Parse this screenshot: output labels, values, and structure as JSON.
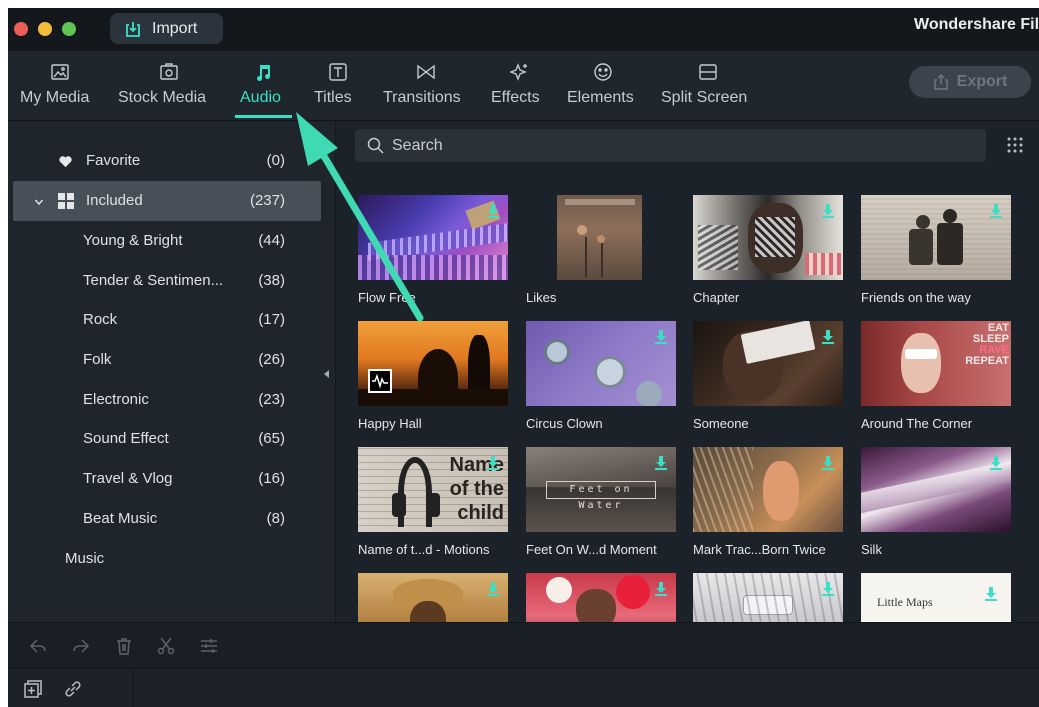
{
  "titlebar": {
    "import_label": "Import",
    "app_title": "Wondershare Filmora"
  },
  "toolbar": {
    "tabs": [
      {
        "label": "My Media",
        "icon": "image-icon"
      },
      {
        "label": "Stock Media",
        "icon": "stock-media-icon"
      },
      {
        "label": "Audio",
        "icon": "music-note-icon",
        "active": true
      },
      {
        "label": "Titles",
        "icon": "titles-icon"
      },
      {
        "label": "Transitions",
        "icon": "transitions-icon"
      },
      {
        "label": "Effects",
        "icon": "effects-icon"
      },
      {
        "label": "Elements",
        "icon": "elements-icon"
      },
      {
        "label": "Split Screen",
        "icon": "split-screen-icon"
      }
    ],
    "export_label": "Export"
  },
  "sidebar": {
    "favorite": {
      "label": "Favorite",
      "count": "(0)"
    },
    "included": {
      "label": "Included",
      "count": "(237)"
    },
    "items": [
      {
        "label": "Young & Bright",
        "count": "(44)"
      },
      {
        "label": "Tender & Sentimen...",
        "count": "(38)"
      },
      {
        "label": "Rock",
        "count": "(17)"
      },
      {
        "label": "Folk",
        "count": "(26)"
      },
      {
        "label": "Electronic",
        "count": "(23)"
      },
      {
        "label": "Sound Effect",
        "count": "(65)"
      },
      {
        "label": "Travel & Vlog",
        "count": "(16)"
      },
      {
        "label": "Beat Music",
        "count": "(8)"
      }
    ],
    "music": {
      "label": "Music"
    }
  },
  "search": {
    "placeholder": "Search"
  },
  "tracks": [
    {
      "label": "Flow Free"
    },
    {
      "label": "Likes"
    },
    {
      "label": "Chapter"
    },
    {
      "label": "Friends on the way"
    },
    {
      "label": "Happy Hall"
    },
    {
      "label": "Circus Clown"
    },
    {
      "label": "Someone"
    },
    {
      "label": "Around The Corner"
    },
    {
      "label": "Name of t...d - Motions",
      "overlay": [
        "Name",
        "of the",
        "child"
      ]
    },
    {
      "label": "Feet On W...d Moment",
      "overlay": [
        "Feet on Water"
      ]
    },
    {
      "label": "Mark Trac...Born Twice"
    },
    {
      "label": "Silk"
    },
    {
      "label": ""
    },
    {
      "label": ""
    },
    {
      "label": ""
    },
    {
      "label": "",
      "overlay": [
        "Little Maps"
      ]
    }
  ],
  "thumb_text": {
    "around_corner": [
      "EAT",
      "SLEEP",
      "RAVE",
      "REPEAT"
    ]
  },
  "colors": {
    "accent": "#3be0c4",
    "background": "#1c2229"
  }
}
